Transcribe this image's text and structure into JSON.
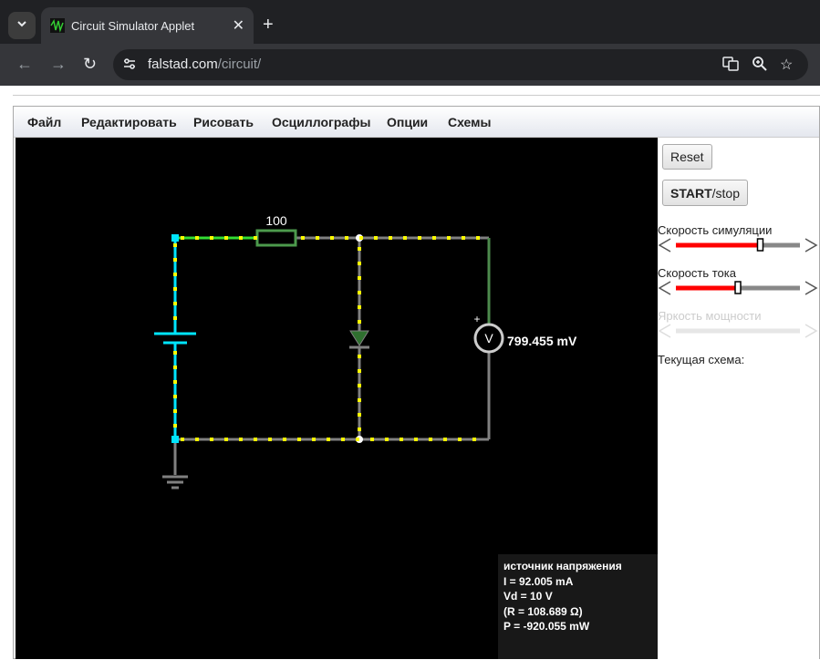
{
  "browser": {
    "tab_title": "Circuit Simulator Applet",
    "url_host": "falstad.com",
    "url_path": "/circuit/"
  },
  "menu": [
    "Файл",
    "Редактировать",
    "Рисовать",
    "Осциллографы",
    "Опции",
    "Схемы"
  ],
  "side": {
    "reset_label": "Reset",
    "start_bold": "START",
    "start_rest": "/stop",
    "sim_speed_label": "Скорость симуляции",
    "sim_speed_value": 0.68,
    "current_speed_label": "Скорость тока",
    "current_speed_value": 0.5,
    "power_brightness_label": "Яркость мощности",
    "current_circuit_label": "Текущая схема:"
  },
  "circuit": {
    "resistor_label": "100",
    "voltmeter_symbol": "V",
    "voltmeter_plus": "+",
    "voltmeter_reading": "799.455 mV"
  },
  "info": {
    "title": "источник напряжения",
    "current": "I = 92.005 mA",
    "vd": "Vd = 10 V",
    "resistance": "(R = 108.689 Ω)",
    "power": "P = -920.055 mW"
  },
  "colors": {
    "wire_cyan": "#00e5ff",
    "wire_green": "#33dd33",
    "wire_gray": "#808080",
    "current_dot": "#ffff00",
    "slider_red": "#ff0000"
  }
}
